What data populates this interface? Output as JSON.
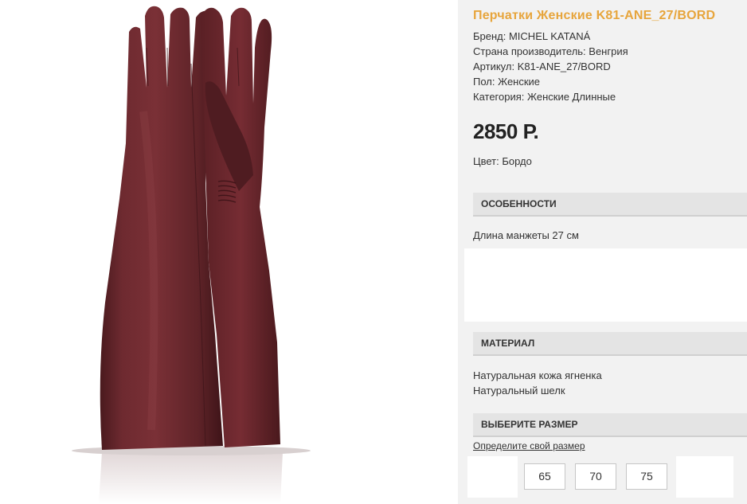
{
  "product": {
    "title": "Перчатки Женские K81-ANE_27/BORD",
    "specs": [
      "Бренд: MICHEL KATANÁ",
      "Страна производитель: Венгрия",
      "Артикул: K81-ANE_27/BORD",
      "Пол: Женские",
      "Категория: Женские Длинные"
    ],
    "price": "2850 Р.",
    "color": "Цвет: Бордо",
    "image_icon": "long-leather-glove",
    "glove_color": "#6b2a2f"
  },
  "features": {
    "header": "ОСОБЕННОСТИ",
    "text": "Длина манжеты 27 см"
  },
  "material": {
    "header": "МАТЕРИАЛ",
    "items": [
      "Натуральная кожа ягненка",
      "Натуральный шелк"
    ]
  },
  "size": {
    "header": "ВЫБЕРИТЕ РАЗМЕР",
    "link": "Определите свой размер",
    "options": [
      "65",
      "70",
      "75"
    ]
  },
  "colors": {
    "title": "#e7a53c",
    "panel_bg": "#f2f2f2",
    "header_bg": "#e4e4e4"
  }
}
